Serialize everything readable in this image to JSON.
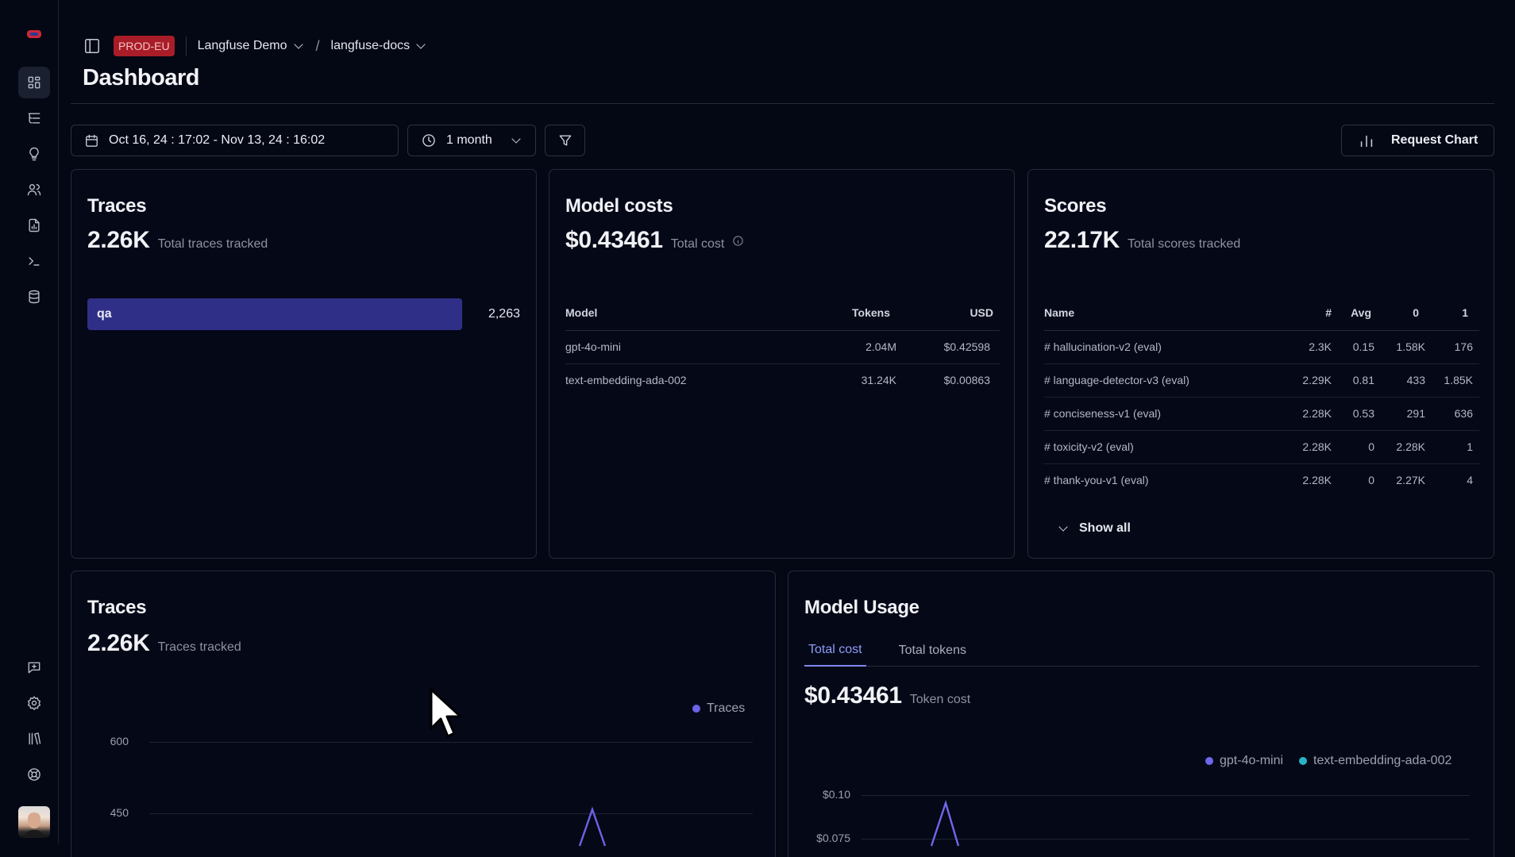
{
  "sidebar": {
    "items": [
      {
        "name": "dashboard",
        "active": true
      },
      {
        "name": "traces"
      },
      {
        "name": "prompts"
      },
      {
        "name": "users"
      },
      {
        "name": "scores"
      },
      {
        "name": "playground"
      },
      {
        "name": "datasets"
      }
    ],
    "bottom_items": [
      {
        "name": "feedback"
      },
      {
        "name": "settings"
      },
      {
        "name": "docs"
      },
      {
        "name": "support"
      }
    ]
  },
  "header": {
    "env_badge": "PROD-EU",
    "org": "Langfuse Demo",
    "project": "langfuse-docs",
    "title": "Dashboard"
  },
  "controls": {
    "date_range": "Oct 16, 24 : 17:02 - Nov 13, 24 : 16:02",
    "period": "1 month",
    "request_chart": "Request Chart"
  },
  "traces_card": {
    "title": "Traces",
    "value": "2.26K",
    "value_label": "Total traces tracked",
    "bar": {
      "label": "qa",
      "value": "2,263",
      "fraction": 1.0
    }
  },
  "model_costs": {
    "title": "Model costs",
    "value": "$0.43461",
    "value_label": "Total cost",
    "columns": [
      "Model",
      "Tokens",
      "USD"
    ],
    "rows": [
      [
        "gpt-4o-mini",
        "2.04M",
        "$0.42598"
      ],
      [
        "text-embedding-ada-002",
        "31.24K",
        "$0.00863"
      ]
    ]
  },
  "scores": {
    "title": "Scores",
    "value": "22.17K",
    "value_label": "Total scores tracked",
    "columns": [
      "Name",
      "#",
      "Avg",
      "0",
      "1"
    ],
    "rows": [
      [
        "# hallucination-v2 (eval)",
        "2.3K",
        "0.15",
        "1.58K",
        "176"
      ],
      [
        "# language-detector-v3 (eval)",
        "2.29K",
        "0.81",
        "433",
        "1.85K"
      ],
      [
        "# conciseness-v1 (eval)",
        "2.28K",
        "0.53",
        "291",
        "636"
      ],
      [
        "# toxicity-v2 (eval)",
        "2.28K",
        "0",
        "2.28K",
        "1"
      ],
      [
        "# thank-you-v1 (eval)",
        "2.28K",
        "0",
        "2.27K",
        "4"
      ]
    ],
    "show_all": "Show all"
  },
  "traces_chart": {
    "title": "Traces",
    "value": "2.26K",
    "value_label": "Traces tracked",
    "legend": "Traces",
    "y_ticks": [
      "600",
      "450"
    ],
    "series_color": "#6b63e8"
  },
  "model_usage": {
    "title": "Model Usage",
    "tabs": [
      "Total cost",
      "Total tokens"
    ],
    "value": "$0.43461",
    "value_label": "Token cost",
    "legend": [
      "gpt-4o-mini",
      "text-embedding-ada-002"
    ],
    "legend_colors": [
      "#6f68ea",
      "#27b4c9"
    ],
    "y_ticks": [
      "$0.10",
      "$0.075"
    ]
  }
}
